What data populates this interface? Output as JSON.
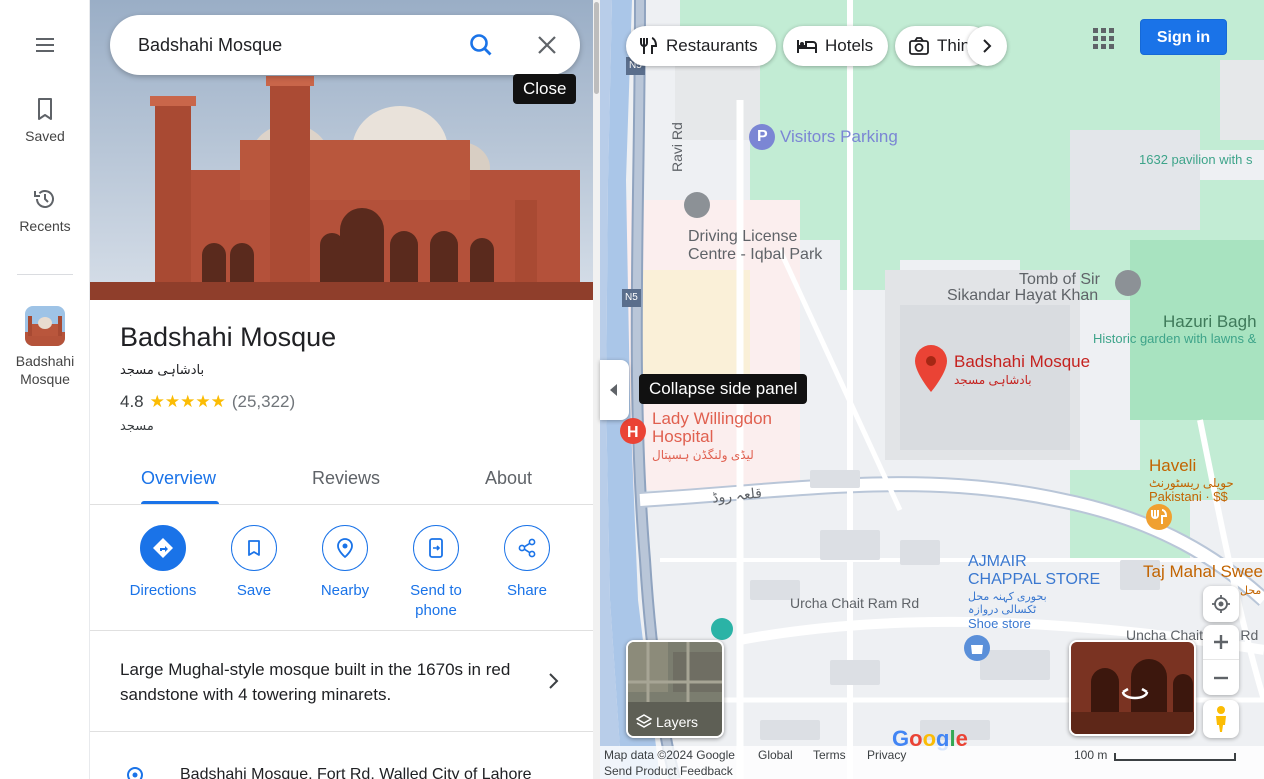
{
  "rail": {
    "menu_icon": "hamburger-menu-icon",
    "saved_label": "Saved",
    "recents_label": "Recents",
    "recent_place_line1": "Badshahi",
    "recent_place_line2": "Mosque"
  },
  "search": {
    "value": "Badshahi Mosque",
    "close_tooltip": "Close"
  },
  "place": {
    "name": "Badshahi Mosque",
    "name_urdu": "بادشاہی مسجد",
    "rating": "4.8",
    "stars": "★★★★★",
    "review_count": "(25,322)",
    "category": "مسجد",
    "description": "Large Mughal-style mosque built in the 1670s in red sandstone with 4 towering minarets.",
    "address": "Badshahi Mosque, Fort Rd, Walled City of Lahore"
  },
  "tabs": {
    "overview": "Overview",
    "reviews": "Reviews",
    "about": "About",
    "active": "Overview"
  },
  "actions": {
    "directions": "Directions",
    "save": "Save",
    "nearby": "Nearby",
    "send_to_phone_line1": "Send to",
    "send_to_phone_line2": "phone",
    "share": "Share"
  },
  "map": {
    "collapse_tooltip": "Collapse side panel",
    "chips": {
      "restaurants": "Restaurants",
      "hotels": "Hotels",
      "things": "Thin"
    },
    "sign_in": "Sign in",
    "layers_label": "Layers",
    "labels": {
      "visitors_parking": "Visitors Parking",
      "pavilion": "1632 pavilion with s",
      "ravi_rd": "Ravi Rd",
      "driving_1": "Driving License",
      "driving_2": "Centre - Iqbal Park",
      "tomb_1": "Tomb of Sir",
      "tomb_2": "Sikandar Hayat Khan",
      "hazuri": "Hazuri Bagh",
      "historic": "Historic garden with lawns &",
      "badshahi": "Badshahi Mosque",
      "badshahi_urdu": "بادشاہی مسجد",
      "lady_1": "Lady Willingdon",
      "lady_2": "Hospital",
      "lady_urdu": "لیڈی ولنگڈن ہسپتال",
      "qila_road": "قلعہ روڈ",
      "haveli": "Haveli",
      "haveli_urdu": "حویلی ریسٹورنٹ",
      "haveli_sub": "Pakistani · $$",
      "ajmair_1": "AJMAIR",
      "ajmair_2": "CHAPPAL STORE",
      "ajmair_urdu_1": "بحوری کہنہ محل",
      "ajmair_urdu_2": "ٹکسالی دروازہ",
      "shoe": "Shoe store",
      "taj": "Taj Mahal Swee",
      "taj_urdu": "محل",
      "urcha_1": "Urcha Chait Ram Rd",
      "urcha_2": "Uncha Chait Ram Rd",
      "n5_top": "N5",
      "n5": "N5"
    },
    "accent": "#1a73e8",
    "pin_color": "#ea4335"
  },
  "footer": {
    "map_data": "Map data ©2024 Google",
    "global": "Global",
    "terms": "Terms",
    "privacy": "Privacy",
    "send_feedback": "Send Product Feedback",
    "scale": "100 m",
    "google": "Google"
  }
}
